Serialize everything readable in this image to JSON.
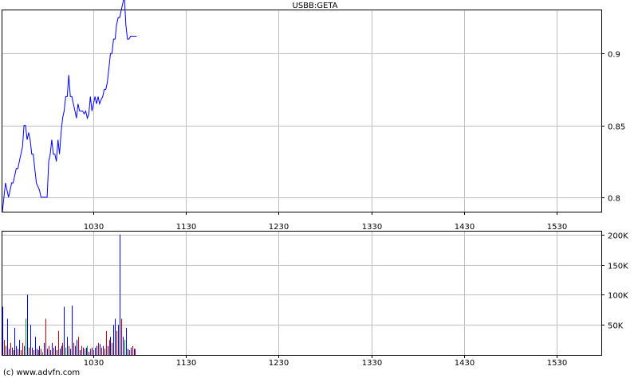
{
  "chart_data": [
    {
      "type": "line",
      "title": "USBB:GETA",
      "xlabel": "",
      "ylabel": "",
      "xlim": [
        "09:31",
        "15:59"
      ],
      "ylim": [
        0.79,
        0.93
      ],
      "x_ticks": [
        "10:30",
        "11:30",
        "12:30",
        "13:30",
        "14:30",
        "15:30"
      ],
      "x_tick_labels": [
        "1030",
        "1130",
        "1230",
        "1330",
        "1430",
        "1530"
      ],
      "y_ticks": [
        0.8,
        0.85,
        0.9
      ],
      "y_tick_labels": [
        "0.8",
        "0.85",
        "0.9"
      ],
      "grid": true,
      "colors": {
        "price": "#0000ff",
        "reference_line": "#e00000"
      },
      "reference_line": {
        "value": 0.79
      },
      "series": [
        {
          "x": [
            "09:31",
            "09:32",
            "09:33",
            "09:35",
            "09:37",
            "09:38",
            "09:40",
            "09:41",
            "09:43",
            "09:44",
            "09:45",
            "09:46",
            "09:47",
            "09:48",
            "09:49",
            "09:50",
            "09:51",
            "09:52",
            "09:53",
            "09:55",
            "09:56",
            "09:57",
            "09:58",
            "09:59",
            "10:00",
            "10:01",
            "10:02",
            "10:03",
            "10:04",
            "10:05",
            "10:06",
            "10:07",
            "10:08",
            "10:09",
            "10:10",
            "10:11",
            "10:12",
            "10:13",
            "10:14",
            "10:15",
            "10:16",
            "10:17",
            "10:18",
            "10:19",
            "10:20",
            "10:21",
            "10:22",
            "10:23",
            "10:24",
            "10:25",
            "10:26",
            "10:27",
            "10:28",
            "10:29",
            "10:30",
            "10:31",
            "10:32",
            "10:33",
            "10:34",
            "10:35",
            "10:36",
            "10:37",
            "10:38",
            "10:39",
            "10:40",
            "10:41",
            "10:42",
            "10:43",
            "10:44",
            "10:45",
            "10:46",
            "10:47",
            "10:48",
            "10:49",
            "10:50",
            "10:51",
            "10:52",
            "10:53",
            "10:54",
            "10:55",
            "10:56",
            "10:57",
            "10:58"
          ],
          "values": [
            0.79,
            0.8,
            0.81,
            0.8,
            0.81,
            0.81,
            0.82,
            0.82,
            0.83,
            0.835,
            0.85,
            0.85,
            0.84,
            0.845,
            0.84,
            0.83,
            0.83,
            0.82,
            0.81,
            0.805,
            0.8,
            0.8,
            0.8,
            0.8,
            0.8,
            0.825,
            0.83,
            0.84,
            0.83,
            0.83,
            0.825,
            0.84,
            0.83,
            0.845,
            0.855,
            0.86,
            0.87,
            0.87,
            0.885,
            0.87,
            0.87,
            0.865,
            0.86,
            0.855,
            0.865,
            0.86,
            0.86,
            0.86,
            0.858,
            0.86,
            0.855,
            0.858,
            0.87,
            0.86,
            0.865,
            0.87,
            0.865,
            0.87,
            0.865,
            0.868,
            0.87,
            0.875,
            0.875,
            0.88,
            0.89,
            0.9,
            0.9,
            0.91,
            0.91,
            0.92,
            0.925,
            0.925,
            0.93,
            0.935,
            0.94,
            0.92,
            0.91,
            0.91,
            0.912,
            0.912,
            0.912,
            0.912,
            0.912
          ]
        }
      ]
    },
    {
      "type": "bar",
      "title": "",
      "xlabel": "",
      "ylabel": "",
      "xlim": [
        "09:31",
        "15:59"
      ],
      "ylim": [
        0,
        205000
      ],
      "x_ticks": [
        "10:30",
        "11:30",
        "12:30",
        "13:30",
        "14:30",
        "15:30"
      ],
      "x_tick_labels": [
        "1030",
        "1130",
        "1230",
        "1330",
        "1430",
        "1530"
      ],
      "y_ticks": [
        50000,
        100000,
        150000,
        200000
      ],
      "y_tick_labels": [
        "50K",
        "100K",
        "150K",
        "200K"
      ],
      "grid": true,
      "colors": {
        "up": "#0000ff",
        "down": "#cc0000",
        "flat": "#00aa00"
      },
      "series": [
        {
          "name": "volume",
          "x": [
            "09:31",
            "09:32",
            "09:33",
            "09:34",
            "09:35",
            "09:36",
            "09:37",
            "09:38",
            "09:39",
            "09:40",
            "09:41",
            "09:42",
            "09:43",
            "09:44",
            "09:45",
            "09:46",
            "09:47",
            "09:48",
            "09:49",
            "09:50",
            "09:51",
            "09:52",
            "09:53",
            "09:54",
            "09:55",
            "09:56",
            "09:57",
            "09:58",
            "09:59",
            "10:00",
            "10:01",
            "10:02",
            "10:03",
            "10:04",
            "10:05",
            "10:06",
            "10:07",
            "10:08",
            "10:09",
            "10:10",
            "10:11",
            "10:12",
            "10:13",
            "10:14",
            "10:15",
            "10:16",
            "10:17",
            "10:18",
            "10:19",
            "10:20",
            "10:21",
            "10:22",
            "10:23",
            "10:24",
            "10:25",
            "10:26",
            "10:27",
            "10:28",
            "10:29",
            "10:30",
            "10:31",
            "10:32",
            "10:33",
            "10:34",
            "10:35",
            "10:36",
            "10:37",
            "10:38",
            "10:39",
            "10:40",
            "10:41",
            "10:42",
            "10:43",
            "10:44",
            "10:45",
            "10:46",
            "10:47",
            "10:48",
            "10:49",
            "10:50",
            "10:51",
            "10:52",
            "10:53",
            "10:54",
            "10:55",
            "10:56",
            "10:57"
          ],
          "values": [
            80000,
            25000,
            15000,
            60000,
            10000,
            20000,
            12000,
            8000,
            45000,
            15000,
            10000,
            25000,
            8000,
            20000,
            15000,
            60000,
            100000,
            12000,
            50000,
            12000,
            8000,
            30000,
            10000,
            8000,
            15000,
            10000,
            5000,
            20000,
            60000,
            10000,
            15000,
            8000,
            20000,
            12000,
            15000,
            8000,
            40000,
            10000,
            15000,
            20000,
            80000,
            12000,
            30000,
            15000,
            10000,
            82000,
            20000,
            15000,
            25000,
            30000,
            8000,
            15000,
            12000,
            10000,
            12000,
            15000,
            5000,
            10000,
            12000,
            8000,
            12000,
            15000,
            20000,
            18000,
            12000,
            15000,
            10000,
            40000,
            15000,
            25000,
            30000,
            20000,
            50000,
            60000,
            40000,
            50000,
            200000,
            60000,
            30000,
            25000,
            45000,
            10000,
            8000,
            12000,
            15000,
            10000,
            10000
          ],
          "direction": [
            "up",
            "down",
            "down",
            "up",
            "up",
            "down",
            "up",
            "down",
            "up",
            "up",
            "down",
            "up",
            "down",
            "down",
            "up",
            "flat",
            "up",
            "down",
            "up",
            "up",
            "down",
            "up",
            "up",
            "down",
            "up",
            "down",
            "flat",
            "up",
            "down",
            "up",
            "down",
            "up",
            "up",
            "down",
            "up",
            "down",
            "down",
            "up",
            "up",
            "down",
            "up",
            "flat",
            "up",
            "down",
            "up",
            "up",
            "down",
            "up",
            "up",
            "down",
            "up",
            "down",
            "up",
            "down",
            "up",
            "flat",
            "up",
            "down",
            "up",
            "down",
            "up",
            "up",
            "down",
            "up",
            "down",
            "up",
            "down",
            "down",
            "up",
            "down",
            "up",
            "down",
            "up",
            "up",
            "down",
            "up",
            "up",
            "down",
            "up",
            "flat",
            "up",
            "up",
            "down",
            "up",
            "down",
            "up",
            "down"
          ]
        }
      ]
    }
  ],
  "footer": {
    "copyright": "(c) www.advfn.com"
  }
}
